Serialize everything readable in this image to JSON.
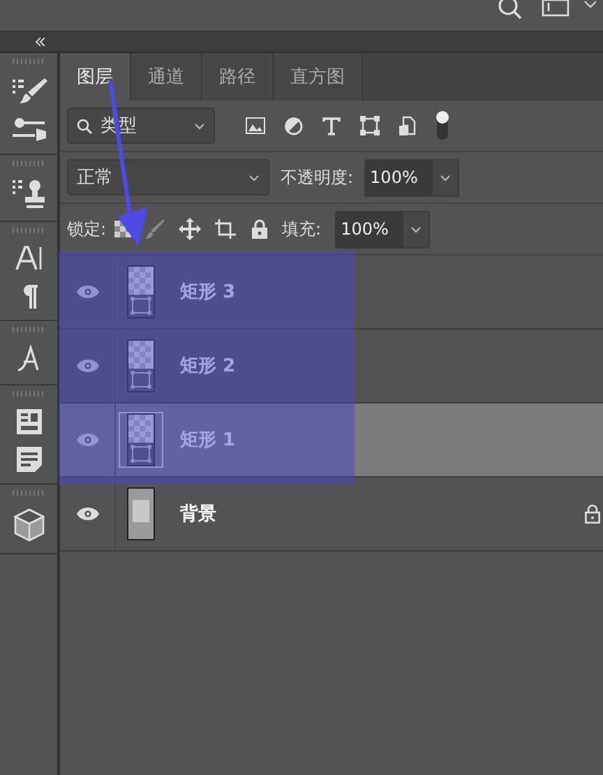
{
  "tabs": [
    {
      "label": "图层",
      "selected": true
    },
    {
      "label": "通道",
      "selected": false
    },
    {
      "label": "路径",
      "selected": false
    },
    {
      "label": "直方图",
      "selected": false
    }
  ],
  "filter": {
    "value": "类型"
  },
  "blend": {
    "value": "正常",
    "opacity_label": "不透明度:",
    "opacity": "100%"
  },
  "lock": {
    "label": "锁定:",
    "fill_label": "填充:",
    "fill": "100%"
  },
  "layers": [
    {
      "name": "矩形 3",
      "kind": "shape",
      "visible": true,
      "selected": false,
      "locked": false
    },
    {
      "name": "矩形 2",
      "kind": "shape",
      "visible": true,
      "selected": false,
      "locked": false
    },
    {
      "name": "矩形 1",
      "kind": "shape",
      "visible": true,
      "selected": true,
      "locked": false
    },
    {
      "name": "背景",
      "kind": "image",
      "visible": true,
      "selected": false,
      "locked": true
    }
  ]
}
